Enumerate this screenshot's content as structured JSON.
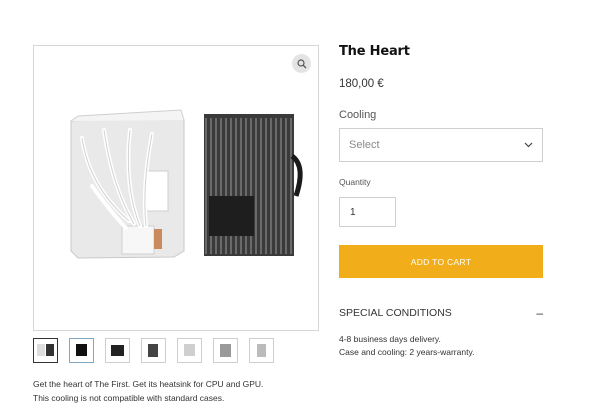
{
  "product": {
    "title": "The Heart",
    "price": "180,00 €",
    "option_label": "Cooling",
    "option_placeholder": "Select",
    "quantity_label": "Quantity",
    "quantity_value": "1",
    "add_to_cart": "ADD TO CART",
    "special_conditions": {
      "heading": "SPECIAL CONDITIONS",
      "toggle_symbol": "–",
      "lines": [
        "4-8 business days delivery.",
        "Case and cooling: 2 years-warranty."
      ]
    },
    "description": [
      "Get the heart of The First. Get its heatsink for CPU and GPU.",
      "This cooling is not compatible with standard cases."
    ],
    "gallery": {
      "zoom_icon": "magnifier-icon",
      "thumbnail_count": 7,
      "selected_thumbnail": 2
    }
  },
  "colors": {
    "accent": "#f2ad1a",
    "border": "#cfcfcf",
    "text": "#333333"
  }
}
